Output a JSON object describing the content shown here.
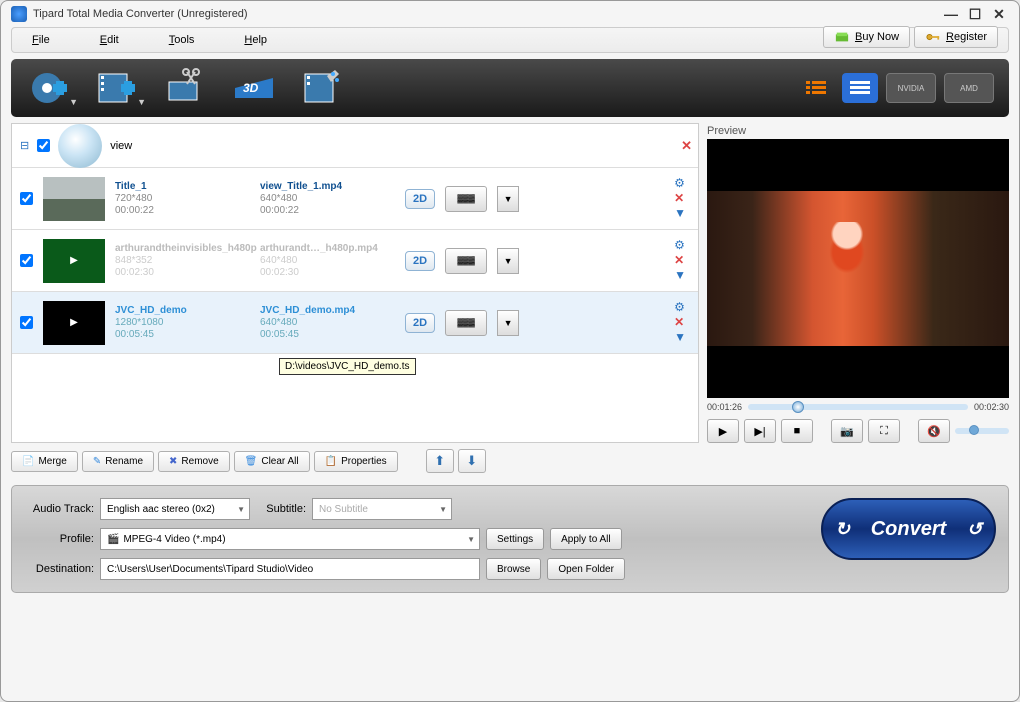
{
  "window": {
    "title": "Tipard Total Media Converter (Unregistered)"
  },
  "menu": {
    "file": "File",
    "edit": "Edit",
    "tools": "Tools",
    "help": "Help"
  },
  "promo": {
    "buy": "Buy Now",
    "register": "Register"
  },
  "group": {
    "name": "view"
  },
  "files": [
    {
      "checked": true,
      "name": "Title_1",
      "res": "720*480",
      "dur": "00:00:22",
      "out_name": "view_Title_1.mp4",
      "out_res": "640*480",
      "out_dur": "00:00:22",
      "mode": "2D",
      "link": false,
      "thumb": "video"
    },
    {
      "checked": true,
      "name": "arthurandtheinvisibles_h480p",
      "res": "848*352",
      "dur": "00:02:30",
      "out_name": "arthurandt…_h480p.mp4",
      "out_res": "640*480",
      "out_dur": "00:02:30",
      "mode": "2D",
      "link": false,
      "thumb": "green"
    },
    {
      "checked": true,
      "name": "JVC_HD_demo",
      "res": "1280*1080",
      "dur": "00:05:45",
      "out_name": "JVC_HD_demo.mp4",
      "out_res": "640*480",
      "out_dur": "00:05:45",
      "mode": "2D",
      "link": true,
      "thumb": "black"
    }
  ],
  "tooltip": "D:\\videos\\JVC_HD_demo.ts",
  "listActions": {
    "merge": "Merge",
    "rename": "Rename",
    "remove": "Remove",
    "clear": "Clear All",
    "props": "Properties"
  },
  "preview": {
    "label": "Preview",
    "current": "00:01:26",
    "total": "00:02:30"
  },
  "form": {
    "audio_label": "Audio Track:",
    "audio_value": "English aac stereo (0x2)",
    "subtitle_label": "Subtitle:",
    "subtitle_value": "No Subtitle",
    "profile_label": "Profile:",
    "profile_value": "MPEG-4 Video (*.mp4)",
    "settings": "Settings",
    "apply": "Apply to All",
    "dest_label": "Destination:",
    "dest_value": "C:\\Users\\User\\Documents\\Tipard Studio\\Video",
    "browse": "Browse",
    "open": "Open Folder"
  },
  "convert": "Convert"
}
